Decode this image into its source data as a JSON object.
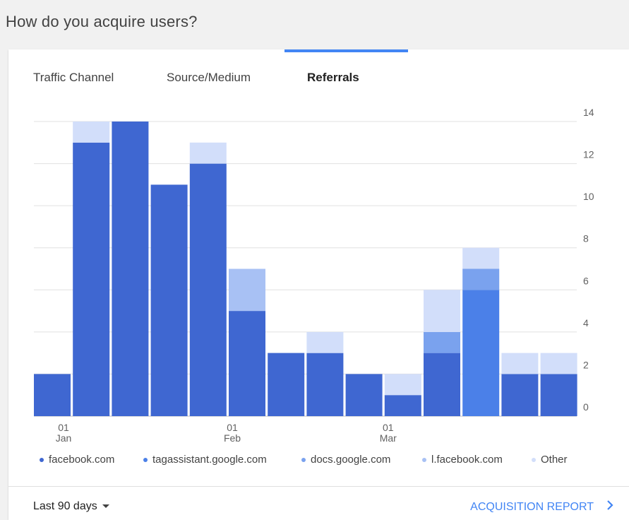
{
  "header": {
    "title": "How do you acquire users?"
  },
  "tabs": [
    {
      "label": "Traffic Channel",
      "active": false
    },
    {
      "label": "Source/Medium",
      "active": false
    },
    {
      "label": "Referrals",
      "active": true
    }
  ],
  "chart_data": {
    "type": "bar",
    "stacked": true,
    "x": [
      "01 Jan",
      "",
      "",
      "",
      "01 Feb",
      "",
      "",
      "",
      "01 Mar",
      "",
      "",
      "",
      "",
      "",
      ""
    ],
    "x_tick_labels": [
      {
        "day": "01",
        "month": "Jan"
      },
      {
        "day": "01",
        "month": "Feb"
      },
      {
        "day": "01",
        "month": "Mar"
      }
    ],
    "ylim": [
      0,
      14
    ],
    "y_ticks": [
      0,
      2,
      4,
      6,
      8,
      10,
      12,
      14
    ],
    "y_axis_position": "right",
    "grid": true,
    "legend_position": "bottom",
    "series": [
      {
        "name": "facebook.com",
        "color": "#3f67d1",
        "values": [
          2,
          13,
          14,
          11,
          12,
          5,
          3,
          3,
          2,
          1,
          3,
          0,
          2,
          2
        ]
      },
      {
        "name": "tagassistant.google.com",
        "color": "#4b80e8",
        "values": [
          0,
          0,
          0,
          0,
          0,
          0,
          0,
          0,
          0,
          0,
          0,
          6,
          0,
          0
        ]
      },
      {
        "name": "docs.google.com",
        "color": "#7aa2ee",
        "values": [
          0,
          0,
          0,
          0,
          0,
          0,
          0,
          0,
          0,
          0,
          1,
          1,
          0,
          0
        ]
      },
      {
        "name": "l.facebook.com",
        "color": "#a8c1f4",
        "values": [
          0,
          0,
          0,
          0,
          0,
          2,
          0,
          0,
          0,
          0,
          0,
          0,
          0,
          0
        ]
      },
      {
        "name": "Other",
        "color": "#d2defa",
        "values": [
          0,
          1,
          0,
          0,
          1,
          0,
          0,
          1,
          0,
          1,
          2,
          1,
          1,
          1
        ]
      }
    ]
  },
  "footer": {
    "range_label": "Last 90 days",
    "report_label": "ACQUISITION REPORT"
  }
}
